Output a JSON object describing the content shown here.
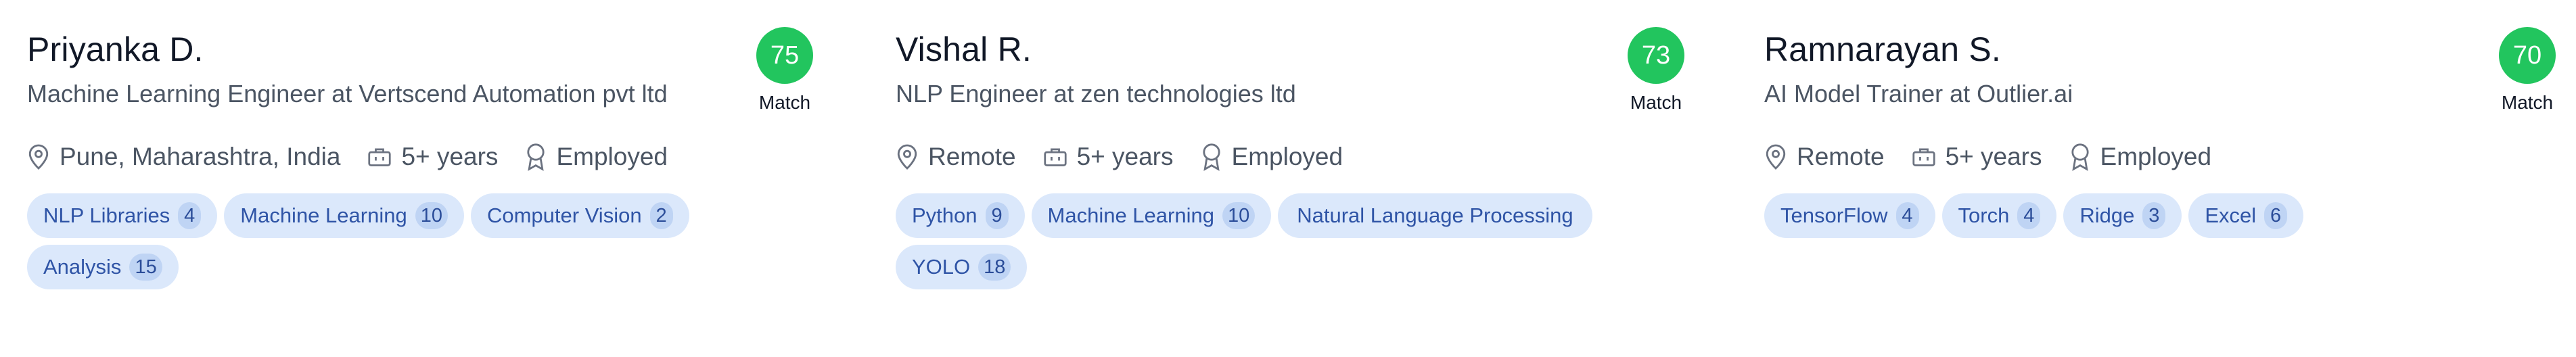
{
  "match_label": "Match",
  "icons": {
    "location": "location-pin-icon",
    "experience": "briefcase-icon",
    "status": "award-badge-icon"
  },
  "colors": {
    "match_badge": "#22c55e",
    "tag_bg": "#dbe8fb",
    "tag_text": "#2f54a6",
    "tag_count_bg": "#bfd4f4"
  },
  "candidates": [
    {
      "name": "Priyanka D.",
      "title": "Machine Learning Engineer at Vertscend Automation pvt ltd",
      "match_score": "75",
      "location": "Pune, Maharashtra, India",
      "experience": "5+ years",
      "status": "Employed",
      "skills": [
        {
          "label": "NLP Libraries",
          "count": "4"
        },
        {
          "label": "Machine Learning",
          "count": "10"
        },
        {
          "label": "Computer Vision",
          "count": "2"
        },
        {
          "label": "Analysis",
          "count": "15"
        }
      ]
    },
    {
      "name": "Vishal R.",
      "title": "NLP Engineer at zen technologies ltd",
      "match_score": "73",
      "location": "Remote",
      "experience": "5+ years",
      "status": "Employed",
      "skills": [
        {
          "label": "Python",
          "count": "9"
        },
        {
          "label": "Machine Learning",
          "count": "10"
        },
        {
          "label": "Natural Language Processing",
          "count": ""
        },
        {
          "label": "YOLO",
          "count": "18"
        }
      ]
    },
    {
      "name": "Ramnarayan S.",
      "title": "AI Model Trainer at Outlier.ai",
      "match_score": "70",
      "location": "Remote",
      "experience": "5+ years",
      "status": "Employed",
      "skills": [
        {
          "label": "TensorFlow",
          "count": "4"
        },
        {
          "label": "Torch",
          "count": "4"
        },
        {
          "label": "Ridge",
          "count": "3"
        },
        {
          "label": "Excel",
          "count": "6"
        }
      ]
    }
  ]
}
